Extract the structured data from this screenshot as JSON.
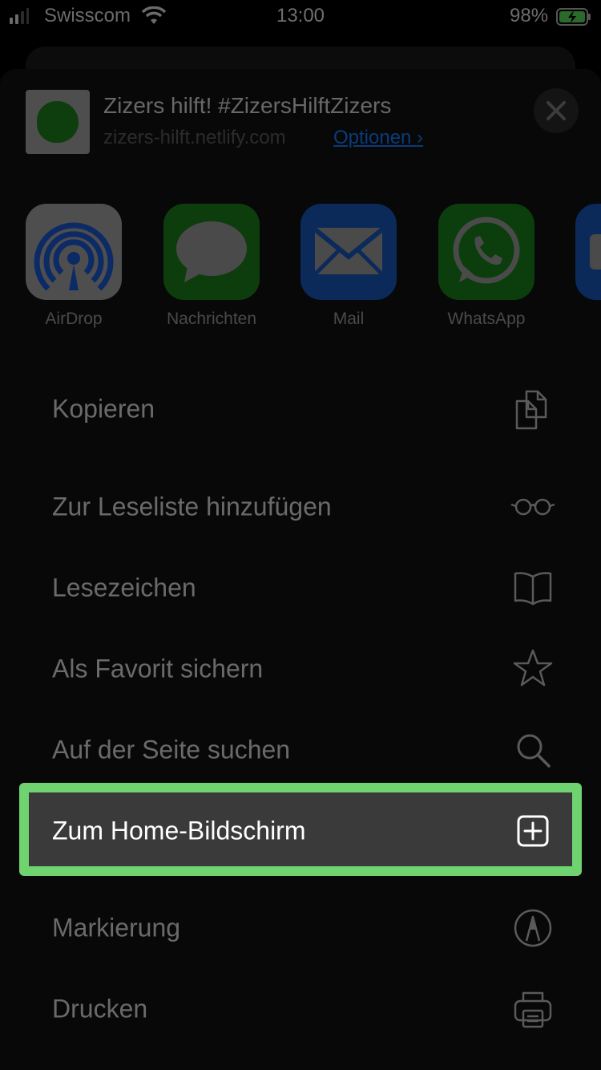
{
  "status_bar": {
    "carrier": "Swisscom",
    "time": "13:00",
    "battery": "98%"
  },
  "share_header": {
    "title": "Zizers hilft! #ZizersHilftZizers",
    "url": "zizers-hilft.netlify.com",
    "options_label": "Optionen"
  },
  "apps": [
    {
      "label": "AirDrop",
      "icon": "airdrop-icon"
    },
    {
      "label": "Nachrichten",
      "icon": "messages-icon"
    },
    {
      "label": "Mail",
      "icon": "mail-icon"
    },
    {
      "label": "WhatsApp",
      "icon": "whatsapp-icon"
    }
  ],
  "actions": [
    {
      "label": "Kopieren",
      "icon": "copy-icon"
    },
    {
      "label": "Zur Leseliste hinzufügen",
      "icon": "glasses-icon"
    },
    {
      "label": "Lesezeichen",
      "icon": "book-icon"
    },
    {
      "label": "Als Favorit sichern",
      "icon": "star-icon"
    },
    {
      "label": "Auf der Seite suchen",
      "icon": "search-icon"
    },
    {
      "label": "Zum Home-Bildschirm",
      "icon": "add-square-icon",
      "highlighted": true
    },
    {
      "label": "Markierung",
      "icon": "markup-icon"
    },
    {
      "label": "Drucken",
      "icon": "printer-icon"
    }
  ],
  "colors": {
    "highlight_border": "#6fd36f",
    "options_link": "#0a3b7a"
  }
}
